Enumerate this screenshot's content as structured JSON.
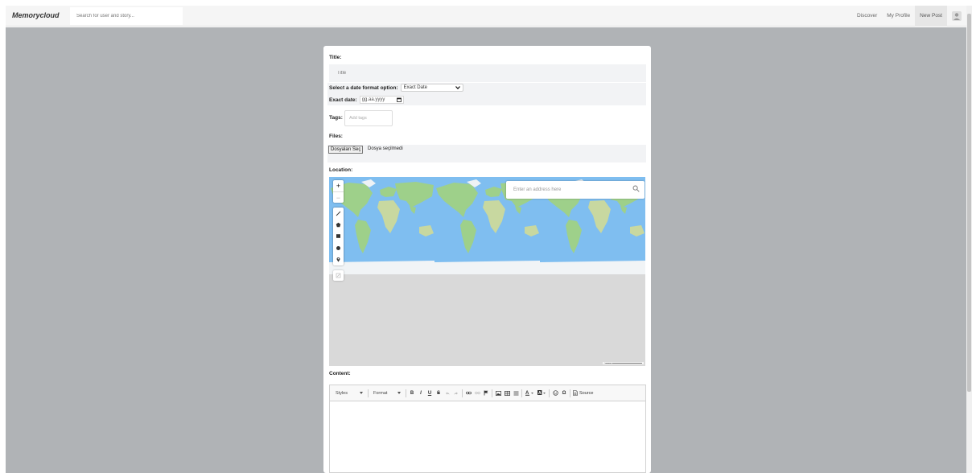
{
  "navbar": {
    "brand": "Memorycloud",
    "search_placeholder": "Search for user and story...",
    "links": [
      "Discover",
      "My Profile",
      "New Post"
    ]
  },
  "form": {
    "title_label": "Title:",
    "title_placeholder": "Title",
    "date_format_label": "Select a date format option:",
    "date_format_selected": "Exact Date",
    "exact_date_label": "Exact date:",
    "exact_date_placeholder": "gg.aa.yyyy",
    "tags_label": "Tags:",
    "tags_placeholder": "Add tags",
    "files_label": "Files:",
    "file_button": "Dosyaları Seç",
    "file_status": "Dosya seçilmedi",
    "location_label": "Location:",
    "map_search_placeholder": "Enter an address here",
    "content_label": "Content:"
  },
  "editor": {
    "styles_label": "Styles",
    "format_label": "Format",
    "source_label": "Source"
  },
  "colors": {
    "stage": "#b0b3b6",
    "ocean": "#7fbef0",
    "land": "#9ed08a"
  }
}
